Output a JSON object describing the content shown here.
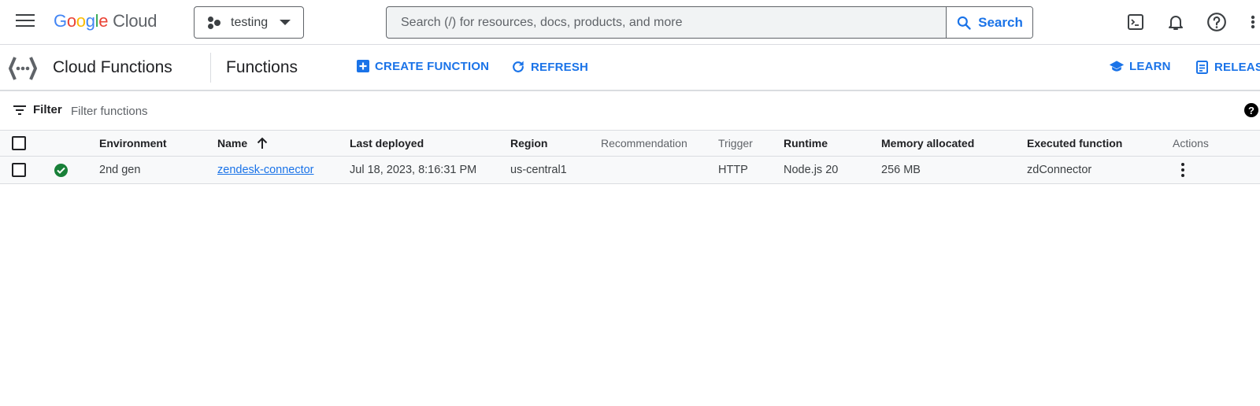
{
  "header": {
    "logo": {
      "g1": "G",
      "o1": "o",
      "o2": "o",
      "g2": "g",
      "l": "l",
      "e": "e",
      "cloud": "Cloud"
    },
    "project": "testing",
    "search": {
      "placeholder": "Search (/) for resources, docs, products, and more",
      "button_label": "Search"
    },
    "icons": [
      "menu-icon",
      "terminal-icon",
      "bell-icon",
      "help-icon",
      "more-vert-icon"
    ]
  },
  "subheader": {
    "product_title": "Cloud Functions",
    "page_title": "Functions",
    "actions": {
      "create": "CREATE FUNCTION",
      "refresh": "REFRESH",
      "learn": "LEARN",
      "release_notes": "RELEASE NOTES"
    }
  },
  "filter": {
    "label": "Filter",
    "placeholder": "Filter functions"
  },
  "table": {
    "columns": {
      "environment": "Environment",
      "name": "Name",
      "last_deployed": "Last deployed",
      "region": "Region",
      "recommendation": "Recommendation",
      "trigger": "Trigger",
      "runtime": "Runtime",
      "memory": "Memory allocated",
      "executed_function": "Executed function",
      "actions": "Actions"
    },
    "sort": {
      "column": "Name",
      "direction": "ascending"
    },
    "rows": [
      {
        "status": "ok",
        "environment": "2nd gen",
        "name": "zendesk-connector",
        "last_deployed": "Jul 18, 2023, 8:16:31 PM",
        "region": "us-central1",
        "recommendation": "",
        "trigger": "HTTP",
        "runtime": "Node.js 20",
        "memory": "256 MB",
        "executed_function": "zdConnector"
      }
    ]
  },
  "colors": {
    "accent": "#1a73e8",
    "status_ok": "#188038",
    "border": "#dadce0",
    "header_bg": "#f8f9fa"
  }
}
